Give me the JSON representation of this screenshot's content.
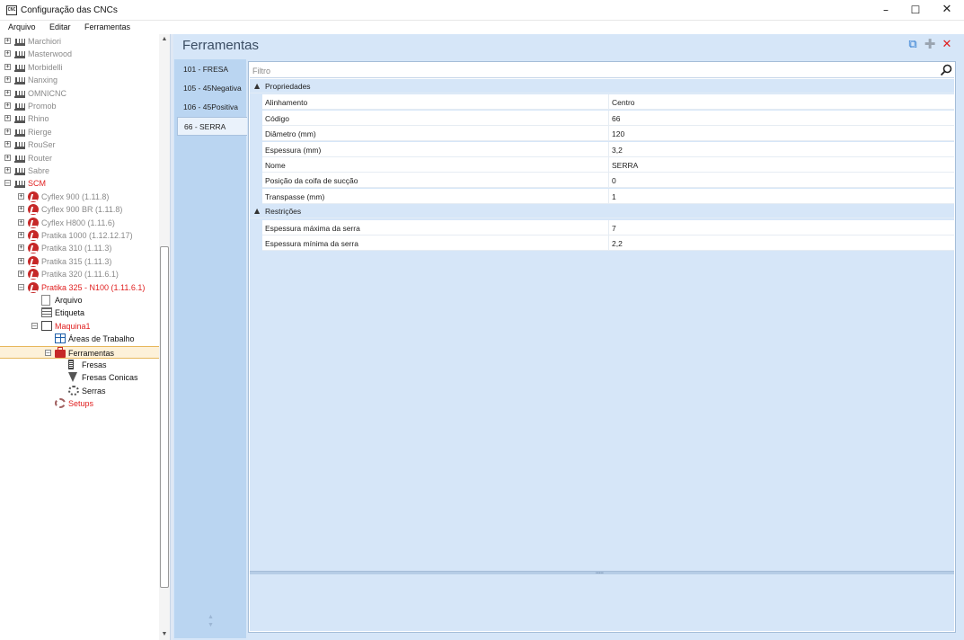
{
  "window": {
    "title": "Configuração das CNCs",
    "app_icon_text": "CNC",
    "minimize": "–",
    "maximize": "☐",
    "close": "✕"
  },
  "menu": {
    "items": [
      "Arquivo",
      "Editar",
      "Ferramentas"
    ]
  },
  "tree": {
    "rows": [
      {
        "label": "Marchiori",
        "indent": 0,
        "exp": "+",
        "icon": "machine",
        "color": "gray"
      },
      {
        "label": "Masterwood",
        "indent": 0,
        "exp": "+",
        "icon": "machine",
        "color": "gray"
      },
      {
        "label": "Morbidelli",
        "indent": 0,
        "exp": "+",
        "icon": "machine",
        "color": "gray"
      },
      {
        "label": "Nanxing",
        "indent": 0,
        "exp": "+",
        "icon": "machine",
        "color": "gray"
      },
      {
        "label": "OMNICNC",
        "indent": 0,
        "exp": "+",
        "icon": "machine",
        "color": "gray"
      },
      {
        "label": "Promob",
        "indent": 0,
        "exp": "+",
        "icon": "machine",
        "color": "gray"
      },
      {
        "label": "Rhino",
        "indent": 0,
        "exp": "+",
        "icon": "machine",
        "color": "gray"
      },
      {
        "label": "Rierge",
        "indent": 0,
        "exp": "+",
        "icon": "machine",
        "color": "gray"
      },
      {
        "label": "RouSer",
        "indent": 0,
        "exp": "+",
        "icon": "machine",
        "color": "gray"
      },
      {
        "label": "Router",
        "indent": 0,
        "exp": "+",
        "icon": "machine",
        "color": "gray"
      },
      {
        "label": "Sabre",
        "indent": 0,
        "exp": "+",
        "icon": "machine",
        "color": "gray"
      },
      {
        "label": "SCM",
        "indent": 0,
        "exp": "–",
        "icon": "machine",
        "color": "red"
      },
      {
        "label": "Cyflex 900 (1.11.8)",
        "indent": 1,
        "exp": "+",
        "icon": "scm",
        "color": "gray"
      },
      {
        "label": "Cyflex 900 BR (1.11.8)",
        "indent": 1,
        "exp": "+",
        "icon": "scm",
        "color": "gray"
      },
      {
        "label": "Cyflex H800 (1.11.6)",
        "indent": 1,
        "exp": "+",
        "icon": "scm",
        "color": "gray"
      },
      {
        "label": "Pratika 1000 (1.12.12.17)",
        "indent": 1,
        "exp": "+",
        "icon": "scm",
        "color": "gray"
      },
      {
        "label": "Pratika 310 (1.11.3)",
        "indent": 1,
        "exp": "+",
        "icon": "scm",
        "color": "gray"
      },
      {
        "label": "Pratika 315 (1.11.3)",
        "indent": 1,
        "exp": "+",
        "icon": "scm",
        "color": "gray"
      },
      {
        "label": "Pratika 320 (1.11.6.1)",
        "indent": 1,
        "exp": "+",
        "icon": "scm",
        "color": "gray"
      },
      {
        "label": "Pratika 325 - N100 (1.11.6.1)",
        "indent": 1,
        "exp": "–",
        "icon": "scm",
        "color": "red"
      },
      {
        "label": "Arquivo",
        "indent": 2,
        "exp": "",
        "icon": "doc",
        "color": "dark"
      },
      {
        "label": "Etiqueta",
        "indent": 2,
        "exp": "",
        "icon": "label",
        "color": "dark"
      },
      {
        "label": "Maquina1",
        "indent": 2,
        "exp": "–",
        "icon": "maq",
        "color": "red"
      },
      {
        "label": "Áreas de Trabalho",
        "indent": 3,
        "exp": "",
        "icon": "areas",
        "color": "dark"
      },
      {
        "label": "Ferramentas",
        "indent": 3,
        "exp": "–",
        "icon": "ferr",
        "color": "dark",
        "selected": true
      },
      {
        "label": "Fresas",
        "indent": 4,
        "exp": "",
        "icon": "fresa",
        "color": "dark"
      },
      {
        "label": "Fresas Conicas",
        "indent": 4,
        "exp": "",
        "icon": "conica",
        "color": "dark"
      },
      {
        "label": "Serras",
        "indent": 4,
        "exp": "",
        "icon": "serra",
        "color": "dark"
      },
      {
        "label": "Setups",
        "indent": 3,
        "exp": "",
        "icon": "setup",
        "color": "red"
      }
    ],
    "scroll_up": "▲",
    "scroll_down": "▼"
  },
  "panel": {
    "title": "Ferramentas",
    "toolbar": {
      "copy_icon": "⧉",
      "add_icon": "✚",
      "delete_icon": "✕"
    }
  },
  "tabs": [
    {
      "label": "101 - FRESA",
      "active": false
    },
    {
      "label": "105 - 45Negativa",
      "active": false
    },
    {
      "label": "106 - 45Positiva",
      "active": false
    },
    {
      "label": "66 - SERRA",
      "active": true
    }
  ],
  "tabs_arrows": {
    "up": "▲",
    "down": "▼"
  },
  "filter": {
    "placeholder": "Filtro",
    "value": ""
  },
  "grid": {
    "categories": [
      {
        "label": "Propriedades",
        "chevron": "▲",
        "props": [
          {
            "name": "Alinhamento",
            "value": "Centro"
          },
          {
            "name": "Código",
            "value": "66"
          },
          {
            "name": "Diâmetro (mm)",
            "value": "120"
          },
          {
            "name": "Espessura (mm)",
            "value": "3,2"
          },
          {
            "name": "Nome",
            "value": "SERRA"
          },
          {
            "name": "Posição da coifa de sucção",
            "value": "0"
          },
          {
            "name": "Transpasse (mm)",
            "value": "1"
          }
        ]
      },
      {
        "label": "Restrições",
        "chevron": "▲",
        "props": [
          {
            "name": "Espessura máxima da serra",
            "value": "7"
          },
          {
            "name": "Espessura mínima da serra",
            "value": "2,2"
          }
        ]
      }
    ],
    "splitter_grip": "•••••"
  }
}
